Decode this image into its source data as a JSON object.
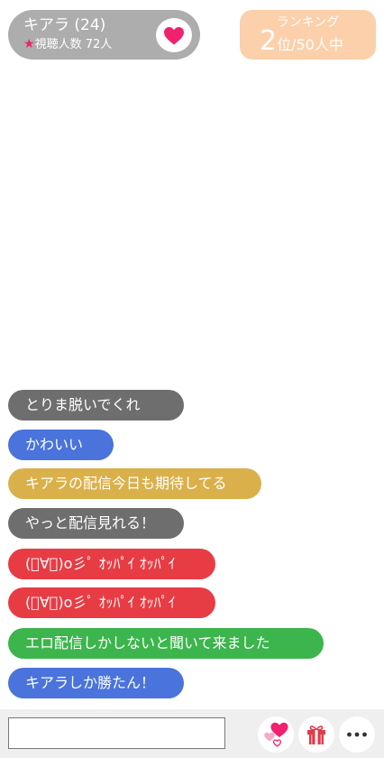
{
  "streamer": {
    "name": "キアラ (24)",
    "viewers_label": "視聴人数",
    "viewers_count": "72人"
  },
  "ranking": {
    "title": "ランキング",
    "rank": "2",
    "suffix": "位/50人中"
  },
  "comments": [
    {
      "text": "とりま脱いでくれ",
      "color": "#6e6e6e"
    },
    {
      "text": "かわいい",
      "color": "#4a73dc"
    },
    {
      "text": "キアラの配信今日も期待してる",
      "color": "#dab04a"
    },
    {
      "text": "やっと配信見れる！",
      "color": "#6e6e6e"
    },
    {
      "text": "(ﾟ∀ﾟ)o彡ﾟ ｵｯﾊﾟｲ ｵｯﾊﾟｲ",
      "color": "#e83c44"
    },
    {
      "text": "(ﾟ∀ﾟ)o彡ﾟ ｵｯﾊﾟｲ ｵｯﾊﾟｲ",
      "color": "#e83c44"
    },
    {
      "text": "エロ配信しかしないと聞いて来ました",
      "color": "#3cb54c"
    },
    {
      "text": "キアラしか勝たん！",
      "color": "#4a73dc"
    }
  ],
  "input": {
    "value": "",
    "placeholder": ""
  },
  "colors": {
    "heart": "#f0216e",
    "pill_bg": "#adadad",
    "ranking_bg": "#fbd0aa",
    "bottom_bar_bg": "#efefef"
  },
  "icons": {
    "like": "heart-icon",
    "send_hearts": "hearts-icon",
    "gift": "gift-icon",
    "more": "more-icon"
  }
}
